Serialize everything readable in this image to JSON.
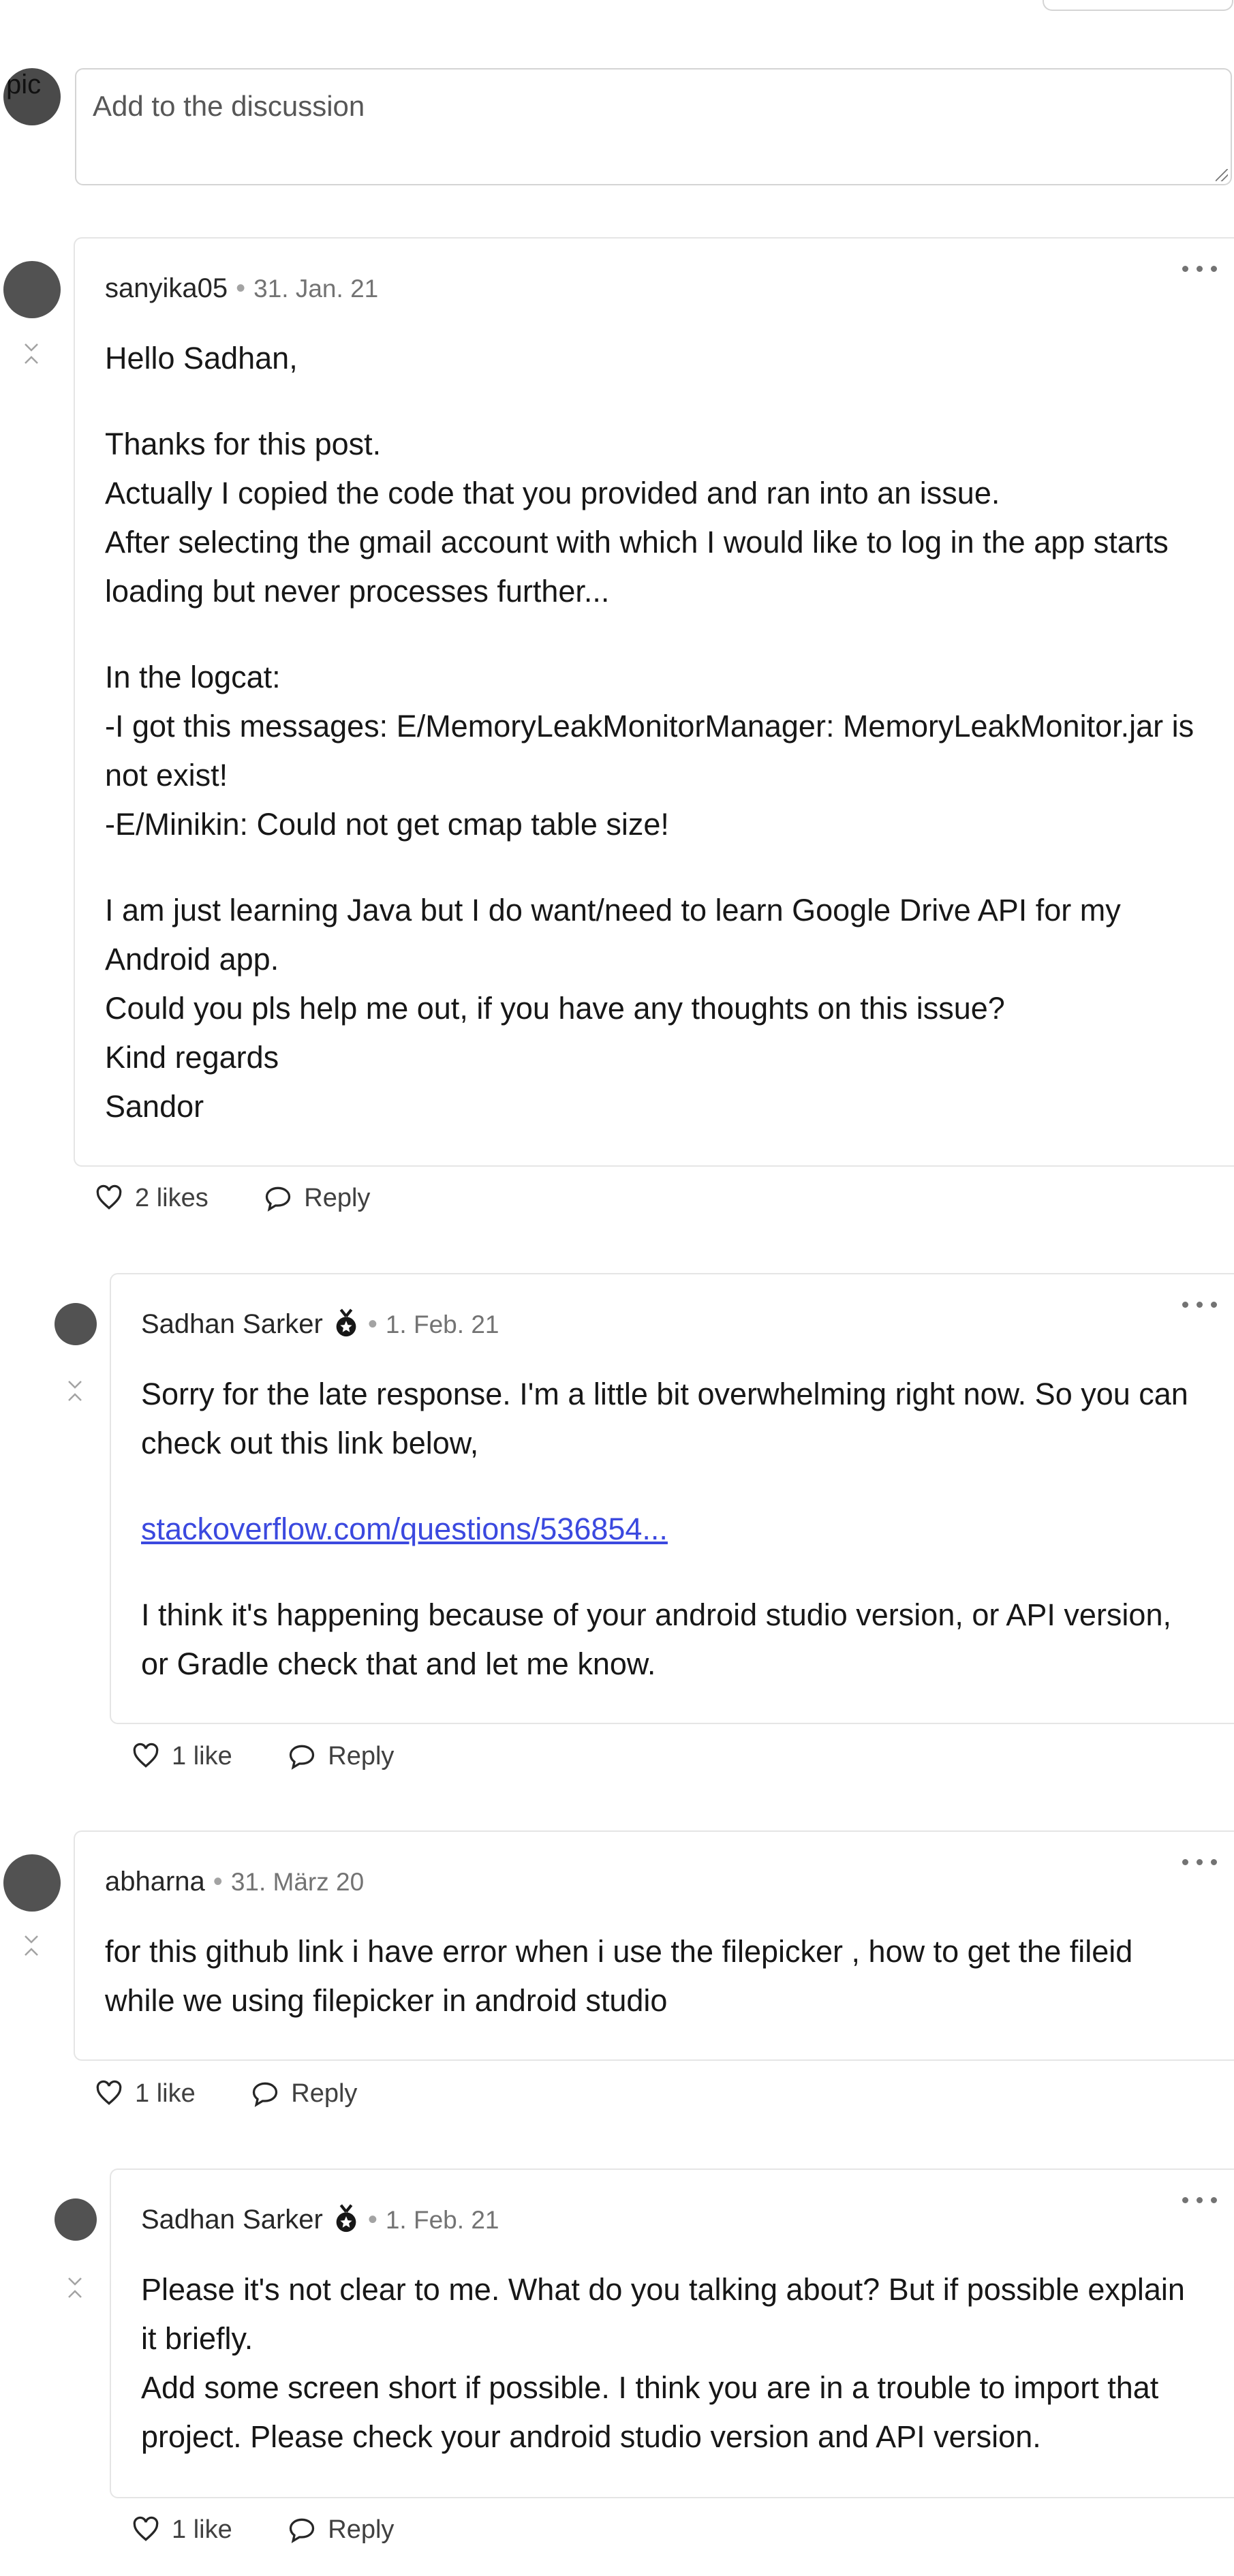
{
  "composer": {
    "avatar_alt": "pic",
    "placeholder": "Add to the discussion"
  },
  "comments": [
    {
      "author": "sanyika05",
      "date": "31. Jan. 21",
      "paragraphs": [
        [
          "Hello Sadhan,"
        ],
        [
          "Thanks for this post.",
          "Actually I copied the code that you provided and ran into an issue.",
          "After selecting the gmail account with which I would like to log in the app starts loading but never processes further..."
        ],
        [
          "In the logcat:",
          "-I got this messages: E/MemoryLeakMonitorManager: MemoryLeakMonitor.jar is not exist!",
          "-E/Minikin: Could not get cmap table size!"
        ],
        [
          "I am just learning Java but I do want/need to learn Google Drive API for my Android app.",
          "Could you pls help me out, if you have any thoughts on this issue?",
          "Kind regards",
          "Sandor"
        ]
      ],
      "likes_label": "2 likes",
      "reply_label": "Reply"
    },
    {
      "author": "Sadhan Sarker",
      "date": "1. Feb. 21",
      "paragraphs": [
        [
          "Sorry for the late response. I'm a little bit overwhelming right now. So you can check out this link below,"
        ],
        [
          "stackoverflow.com/questions/536854..."
        ],
        [
          "I think it's happening because of your android studio version, or API version, or Gradle check that and let me know."
        ]
      ],
      "link_text": "stackoverflow.com/questions/536854...",
      "likes_label": "1 like",
      "reply_label": "Reply"
    },
    {
      "author": "abharna",
      "date": "31. März 20",
      "paragraphs": [
        [
          "for this github link i have error when i use the filepicker , how to get the fileid while we using filepicker in android studio"
        ]
      ],
      "likes_label": "1 like",
      "reply_label": "Reply"
    },
    {
      "author": "Sadhan Sarker",
      "date": "1. Feb. 21",
      "paragraphs": [
        [
          "Please it's not clear to me. What do you talking about? But if possible explain it briefly.",
          "Add some screen short if possible. I think you are in a trouble to import that project. Please check your android studio version and API version."
        ]
      ],
      "likes_label": "1 like",
      "reply_label": "Reply"
    }
  ],
  "colors": {
    "link": "#3b49df",
    "border": "#e5e5e5",
    "avatar": "#525252"
  }
}
